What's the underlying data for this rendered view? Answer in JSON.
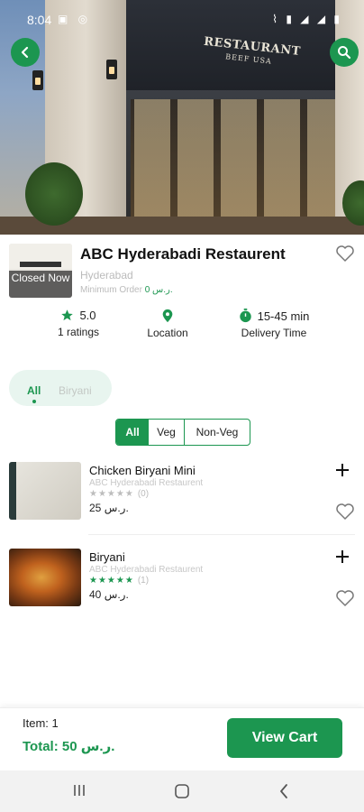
{
  "status_bar": {
    "time": "8:04",
    "left_icons": "▣ ◎",
    "right_icons": "⌇ ▮ ◢ ◢ ▮"
  },
  "restaurant": {
    "name": "ABC Hyderabadi Restaurent",
    "city": "Hyderabad",
    "min_order_label": "Minimum Order",
    "min_order_amount": "0 ر.س.",
    "status_overlay": "Closed Now",
    "hero_sign_title": "RESTAURANT",
    "hero_sign_sub": "BEEF USA"
  },
  "stats": {
    "rating_value": "5.0",
    "rating_label": "1 ratings",
    "location_label": "Location",
    "delivery_value": "15-45 min",
    "delivery_label": "Delivery Time"
  },
  "categories": [
    "All",
    "Biryani"
  ],
  "filters": [
    "All",
    "Veg",
    "Non-Veg"
  ],
  "menu_items": [
    {
      "title": "Chicken Biryani Mini",
      "restaurant": "ABC Hyderabadi Restaurent",
      "rating_count": "(0)",
      "price": "25 ر.س.",
      "stars_color": "#bdbdbd",
      "rating": 0
    },
    {
      "title": "Biryani",
      "restaurant": "ABC Hyderabadi Restaurent",
      "rating_count": "(1)",
      "price": "40 ر.س.",
      "stars_color": "#1c9650",
      "rating": 5
    }
  ],
  "cart": {
    "items_label": "Item: 1",
    "total_label": "Total: 50 ر.س.",
    "view_cart_label": "View Cart"
  },
  "colors": {
    "accent": "#1c9650",
    "accent_light": "#e8f5ef"
  },
  "icons": {
    "back": "chevron-left-icon",
    "search": "search-icon",
    "favorite": "heart-outline-icon",
    "star": "star-icon",
    "location": "map-pin-icon",
    "timer": "stopwatch-icon",
    "add": "plus-icon"
  }
}
